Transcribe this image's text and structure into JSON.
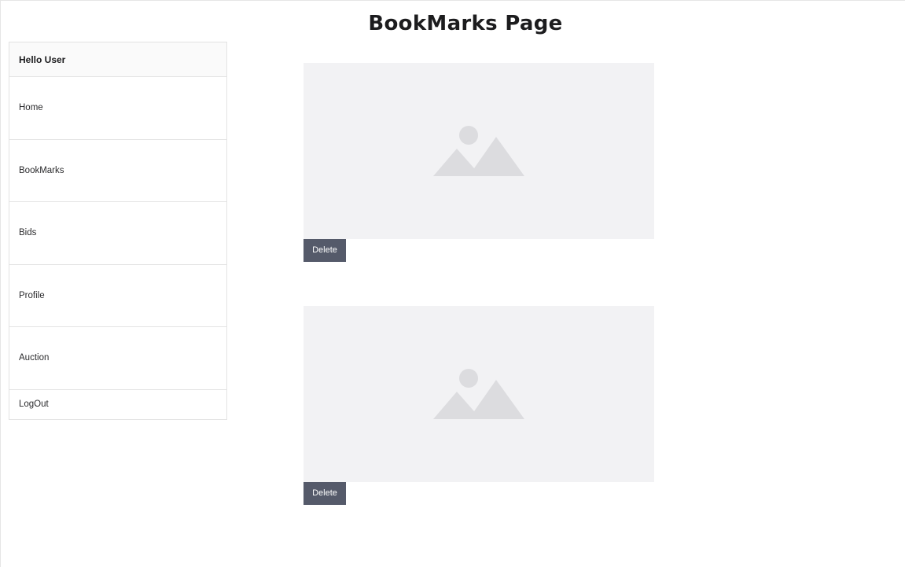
{
  "header": {
    "title": "BookMarks Page"
  },
  "sidebar": {
    "greeting": "Hello User",
    "items": [
      {
        "label": "Home"
      },
      {
        "label": "BookMarks"
      },
      {
        "label": "Bids"
      },
      {
        "label": "Profile"
      },
      {
        "label": "Auction"
      },
      {
        "label": "LogOut"
      }
    ]
  },
  "bookmarks": [
    {
      "image_icon": "image-placeholder-icon",
      "delete_label": "Delete"
    },
    {
      "image_icon": "image-placeholder-icon",
      "delete_label": "Delete"
    }
  ],
  "colors": {
    "delete_button": "#555a6a",
    "placeholder_bg": "#f2f2f4",
    "placeholder_icon": "#dcdcdf"
  }
}
